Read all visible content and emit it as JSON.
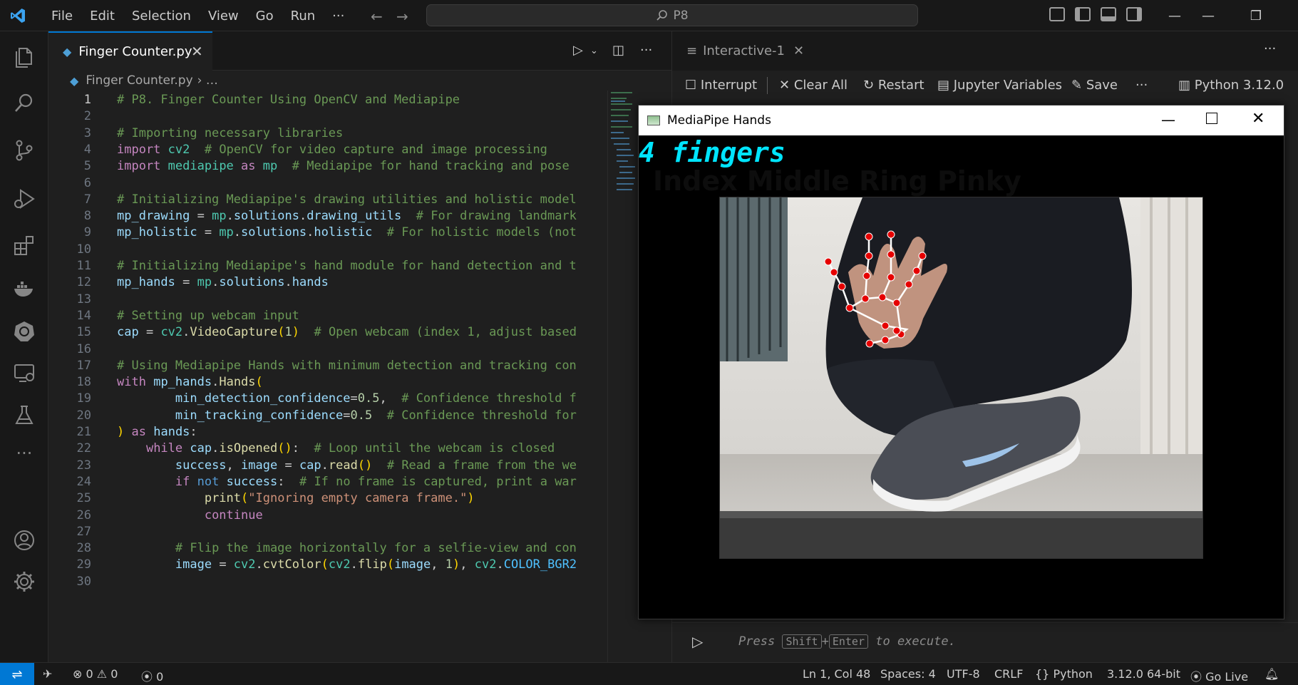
{
  "menu": [
    "File",
    "Edit",
    "Selection",
    "View",
    "Go",
    "Run",
    "···"
  ],
  "search": "P8",
  "editor": {
    "tab": "Finger Counter.py",
    "breadcrumb_file": "Finger Counter.py",
    "breadcrumb_rest": "› …",
    "lines": [
      {
        "n": "1",
        "t": "# P8. Finger Counter Using OpenCV and Mediapipe"
      },
      {
        "n": "2",
        "t": ""
      },
      {
        "n": "3",
        "t": "# Importing necessary libraries"
      },
      {
        "n": "4",
        "t": "import cv2  # OpenCV for video capture and image processing"
      },
      {
        "n": "5",
        "t": "import mediapipe as mp  # Mediapipe for hand tracking and pose"
      },
      {
        "n": "6",
        "t": ""
      },
      {
        "n": "7",
        "t": "# Initializing Mediapipe's drawing utilities and holistic model"
      },
      {
        "n": "8",
        "t": "mp_drawing = mp.solutions.drawing_utils  # For drawing landmark"
      },
      {
        "n": "9",
        "t": "mp_holistic = mp.solutions.holistic  # For holistic models (not"
      },
      {
        "n": "10",
        "t": ""
      },
      {
        "n": "11",
        "t": "# Initializing Mediapipe's hand module for hand detection and t"
      },
      {
        "n": "12",
        "t": "mp_hands = mp.solutions.hands"
      },
      {
        "n": "13",
        "t": ""
      },
      {
        "n": "14",
        "t": "# Setting up webcam input"
      },
      {
        "n": "15",
        "t": "cap = cv2.VideoCapture(1)  # Open webcam (index 1, adjust based"
      },
      {
        "n": "16",
        "t": ""
      },
      {
        "n": "17",
        "t": "# Using Mediapipe Hands with minimum detection and tracking con"
      },
      {
        "n": "18",
        "t": "with mp_hands.Hands("
      },
      {
        "n": "19",
        "t": "        min_detection_confidence=0.5,  # Confidence threshold f"
      },
      {
        "n": "20",
        "t": "        min_tracking_confidence=0.5  # Confidence threshold for"
      },
      {
        "n": "21",
        "t": ") as hands:"
      },
      {
        "n": "22",
        "t": "    while cap.isOpened():  # Loop until the webcam is closed"
      },
      {
        "n": "23",
        "t": "        success, image = cap.read()  # Read a frame from the we"
      },
      {
        "n": "24",
        "t": "        if not success:  # If no frame is captured, print a war"
      },
      {
        "n": "25",
        "t": "            print(\"Ignoring empty camera frame.\")"
      },
      {
        "n": "26",
        "t": "            continue"
      },
      {
        "n": "27",
        "t": ""
      },
      {
        "n": "28",
        "t": "        # Flip the image horizontally for a selfie-view and con"
      },
      {
        "n": "29",
        "t": "        image = cv2.cvtColor(cv2.flip(image, 1), cv2.COLOR_BGR2"
      },
      {
        "n": "30",
        "t": ""
      }
    ]
  },
  "interactive": {
    "tab": "Interactive-1",
    "interrupt": "Interrupt",
    "clear_all": "Clear All",
    "restart": "Restart",
    "variables": "Jupyter Variables",
    "save": "Save",
    "kernel": "Python 3.12.0",
    "hint_press": "Press",
    "hint_shift": "Shift",
    "hint_plus": "+",
    "hint_enter": "Enter",
    "hint_rest": "to execute."
  },
  "mediapipe": {
    "title": "MediaPipe Hands",
    "finger_text": "4 fingers",
    "ghost_text": "Index Middle Ring Pinky"
  },
  "status": {
    "errors": "0",
    "warnings": "0",
    "ports": "0",
    "position": "Ln 1, Col 48",
    "spaces": "Spaces: 4",
    "encoding": "UTF-8",
    "eol": "CRLF",
    "language": "Python",
    "interpreter": "3.12.0 64-bit",
    "golive": "Go Live"
  }
}
